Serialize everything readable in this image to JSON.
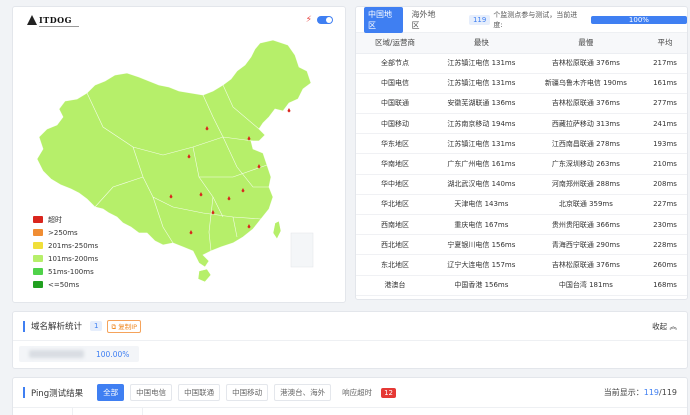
{
  "logo": {
    "text": "ITDOG"
  },
  "legend": [
    {
      "label": "超时",
      "color": "#d9251d"
    },
    {
      "label": ">250ms",
      "color": "#f08d33"
    },
    {
      "label": "201ms-250ms",
      "color": "#f0df3a"
    },
    {
      "label": "101ms-200ms",
      "color": "#b6ef6a"
    },
    {
      "label": "51ms-100ms",
      "color": "#50d24a"
    },
    {
      "label": "<=50ms",
      "color": "#21a020"
    }
  ],
  "map": {
    "fill_color": "#b6ef6a",
    "marker_color": "#d9251d"
  },
  "tabs": {
    "domestic": "中国地区",
    "overseas": "海外地区"
  },
  "progress": {
    "count": "119",
    "text": "个监测点参与测试，当前进度:",
    "value_label": "100%",
    "value": 1.0
  },
  "table": {
    "headers": [
      "区域/运营商",
      "最快",
      "最慢",
      "平均"
    ],
    "rows": [
      [
        "全部节点",
        "江苏镇江电信 131ms",
        "吉林松原联通 376ms",
        "217ms"
      ],
      [
        "中国电信",
        "江苏镇江电信 131ms",
        "新疆乌鲁木齐电信 190ms",
        "161ms"
      ],
      [
        "中国联通",
        "安徽芜湖联通 136ms",
        "吉林松原联通 376ms",
        "277ms"
      ],
      [
        "中国移动",
        "江苏南京移动 194ms",
        "西藏拉萨移动 313ms",
        "241ms"
      ],
      [
        "华东地区",
        "江苏镇江电信 131ms",
        "江西南昌联通 278ms",
        "193ms"
      ],
      [
        "华南地区",
        "广东广州电信 161ms",
        "广东深圳移动 263ms",
        "210ms"
      ],
      [
        "华中地区",
        "湖北武汉电信 140ms",
        "河南郑州联通 288ms",
        "208ms"
      ],
      [
        "华北地区",
        "天津电信 143ms",
        "北京联通 359ms",
        "227ms"
      ],
      [
        "西南地区",
        "重庆电信 167ms",
        "贵州贵阳联通 366ms",
        "230ms"
      ],
      [
        "西北地区",
        "宁夏银川电信 156ms",
        "青海西宁联通 290ms",
        "228ms"
      ],
      [
        "东北地区",
        "辽宁大连电信 157ms",
        "吉林松原联通 376ms",
        "260ms"
      ],
      [
        "港澳台",
        "中国香港 156ms",
        "中国台湾 181ms",
        "168ms"
      ]
    ]
  },
  "dns": {
    "title": "域名解析统计",
    "count": "1",
    "ip_label": "复制IP",
    "collapse_label": "收起",
    "percent": "100.00%"
  },
  "ping": {
    "title": "Ping测试结果",
    "filters": [
      "全部",
      "中国电信",
      "中国联通",
      "中国移动",
      "港澳台、海外",
      "响应超时"
    ],
    "timeout_count": "12",
    "display_label": "当前显示：",
    "display_shown": "119",
    "display_total": "/119"
  },
  "colors": {
    "accent": "#3f7ff2",
    "danger": "#e53935"
  }
}
